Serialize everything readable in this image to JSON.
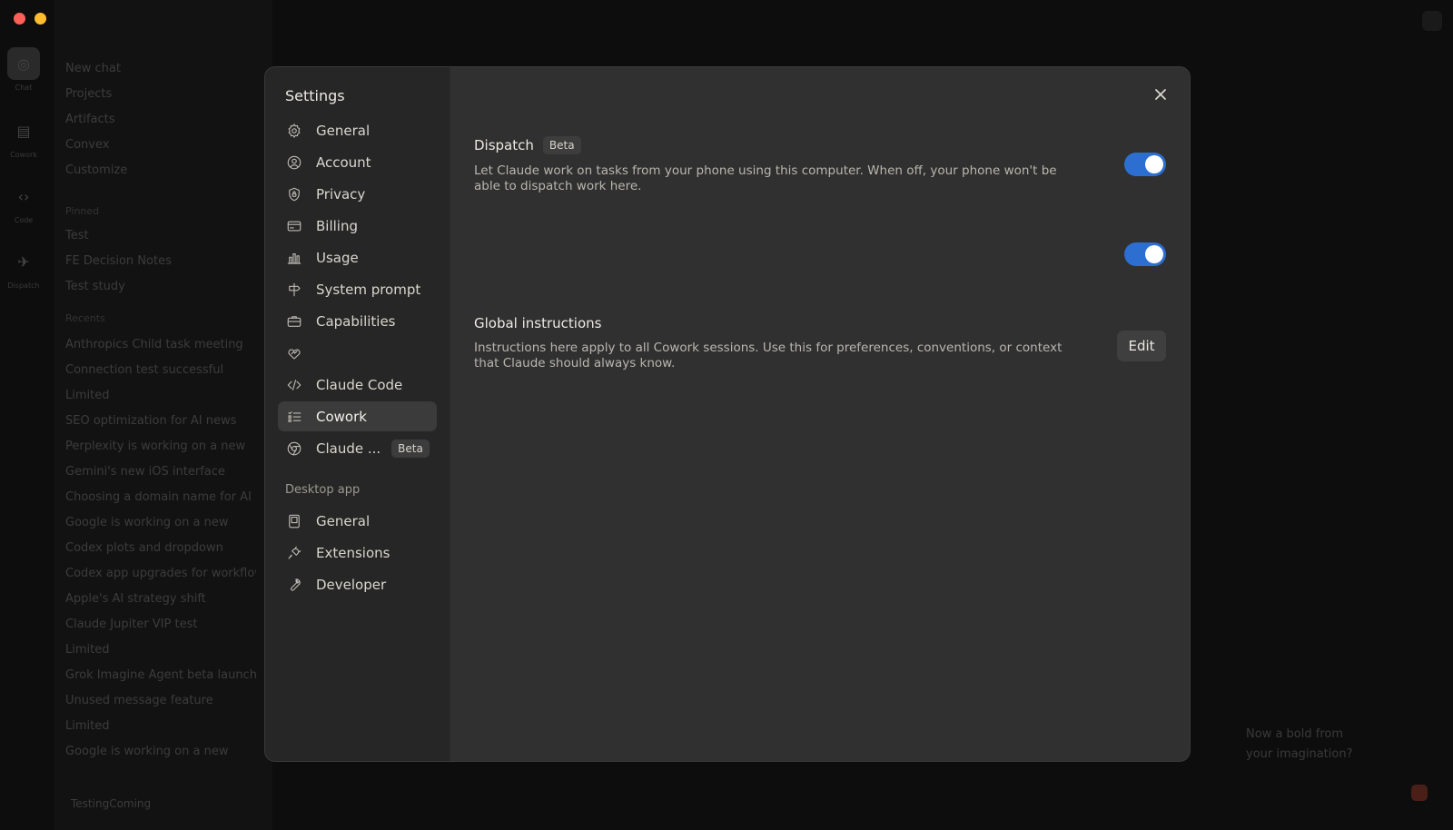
{
  "background": {
    "nav": [
      "New chat",
      "Projects",
      "Artifacts",
      "Convex",
      "Customize"
    ],
    "rail_labels": [
      "Chat",
      "Cowork",
      "Code",
      "Dispatch"
    ],
    "section_pinned": "Pinned",
    "pinned": [
      "Test",
      "FE Decision Notes",
      "Test study"
    ],
    "section_recents": "Recents",
    "recents": [
      "Anthropics Child task meeting",
      "Connection test successful",
      "Limited",
      "SEO optimization for AI news",
      "Perplexity is working on a new",
      "Gemini's new iOS interface",
      "Choosing a domain name for AI",
      "Google is working on a new",
      "Codex plots and dropdown",
      "Codex app upgrades for workflow",
      "Apple's AI strategy shift",
      "Claude Jupiter VIP test",
      "Limited",
      "Grok Imagine Agent beta launch",
      "Unused message feature",
      "Limited",
      "Google is working on a new"
    ],
    "user": "TestingComing",
    "note": "Now a bold from your imagination?"
  },
  "settings": {
    "title": "Settings",
    "nav": [
      {
        "label": "General",
        "icon": "gear-icon"
      },
      {
        "label": "Account",
        "icon": "user-circle-icon"
      },
      {
        "label": "Privacy",
        "icon": "shield-icon"
      },
      {
        "label": "Billing",
        "icon": "credit-card-icon"
      },
      {
        "label": "Usage",
        "icon": "bar-chart-icon"
      },
      {
        "label": "System prompt",
        "icon": "signpost-icon"
      },
      {
        "label": "Capabilities",
        "icon": "briefcase-icon"
      },
      {
        "label": "",
        "icon": "connectors-icon"
      },
      {
        "label": "Claude Code",
        "icon": "code-icon"
      },
      {
        "label": "Cowork",
        "icon": "checklist-icon"
      },
      {
        "label": "Claude ...",
        "icon": "globe-icon",
        "badge": "Beta"
      }
    ],
    "active": "Cowork",
    "desktop_section": "Desktop app",
    "desktop_nav": [
      {
        "label": "General",
        "icon": "device-icon"
      },
      {
        "label": "Extensions",
        "icon": "plug-icon"
      },
      {
        "label": "Developer",
        "icon": "wrench-icon"
      }
    ]
  },
  "content": {
    "dispatch": {
      "title": "Dispatch",
      "badge": "Beta",
      "description": "Let Claude work on tasks from your phone using this computer. When off, your phone won't be able to dispatch work here.",
      "enabled": true
    },
    "second_toggle": {
      "enabled": true
    },
    "global_instructions": {
      "title": "Global instructions",
      "description": "Instructions here apply to all Cowork sessions. Use this for preferences, conventions, or context that Claude should always know.",
      "button": "Edit"
    }
  },
  "colors": {
    "accent": "#2c6fd1",
    "modal_bg": "#303030",
    "sidebar_bg": "#262626"
  }
}
